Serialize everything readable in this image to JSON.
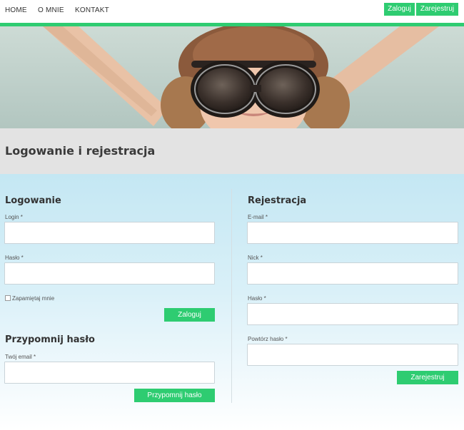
{
  "nav": {
    "items": [
      "HOME",
      "O MNIE",
      "KONTAKT"
    ],
    "login_label": "Zaloguj",
    "register_label": "Zarejestruj"
  },
  "page_title": "Logowanie i rejestracja",
  "login": {
    "title": "Logowanie",
    "login_label": "Login *",
    "password_label": "Hasło *",
    "remember_label": "Zapamiętaj mnie",
    "submit_label": "Zaloguj"
  },
  "remind": {
    "title": "Przypomnij hasło",
    "email_label": "Twój email *",
    "submit_label": "Przypomnij hasło"
  },
  "register": {
    "title": "Rejestracja",
    "email_label": "E-mail *",
    "nick_label": "Nick *",
    "password_label": "Hasło *",
    "repeat_password_label": "Powtórz hasło *",
    "submit_label": "Zarejestruj"
  },
  "colors": {
    "accent": "#2ecc71",
    "title_band": "#e3e3e3",
    "content_top": "#c4e7f3"
  }
}
